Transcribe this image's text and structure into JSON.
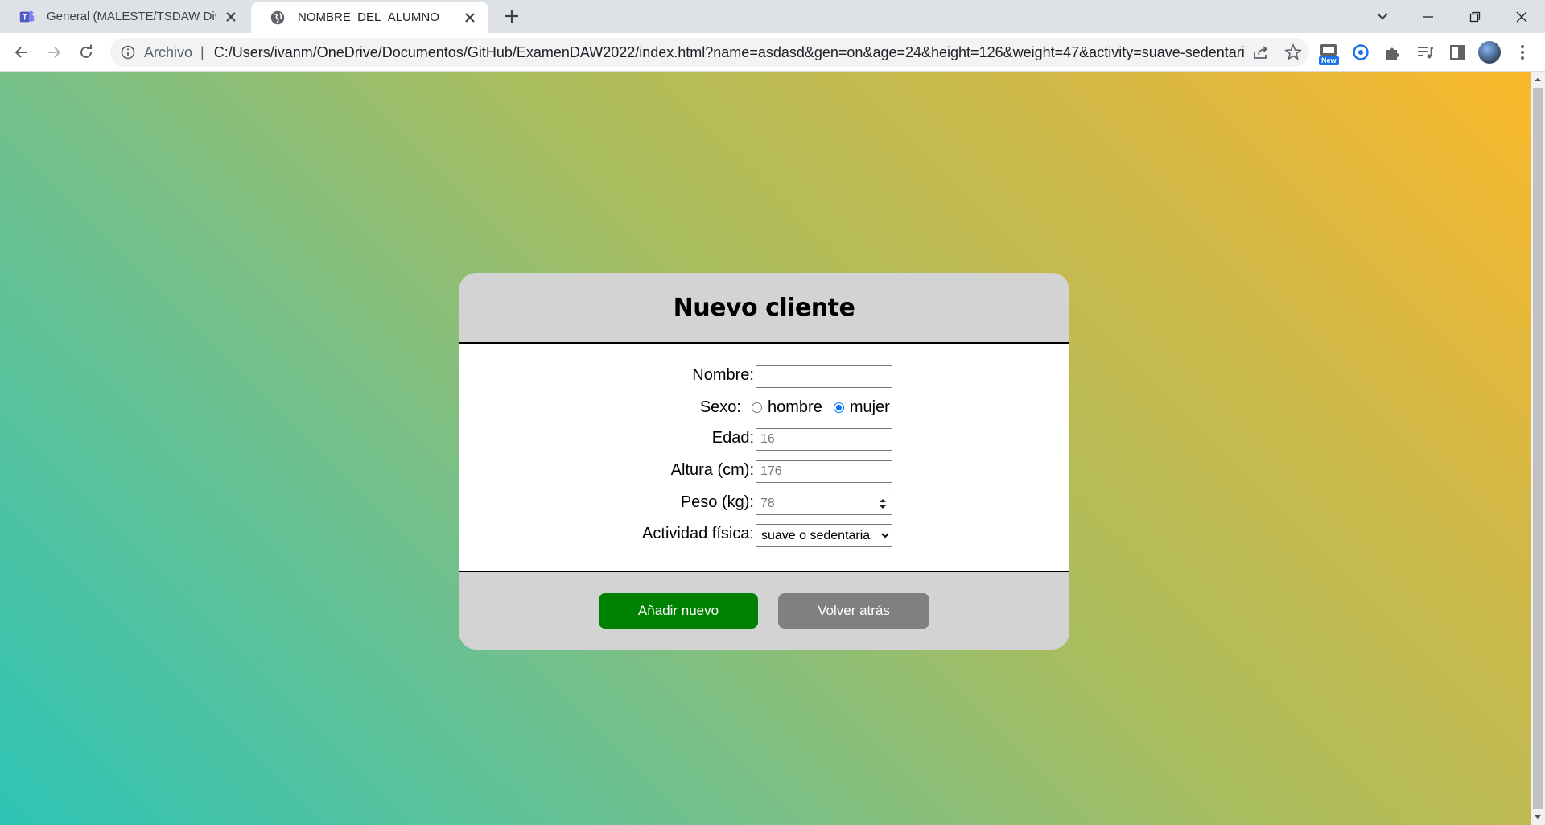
{
  "browser": {
    "tabs": [
      {
        "title": "General (MALESTE/TSDAW Diseño",
        "icon": "teams-icon",
        "active": false
      },
      {
        "title": "NOMBRE_DEL_ALUMNO",
        "icon": "globe-icon",
        "active": true
      }
    ],
    "address": {
      "scheme_label": "Archivo",
      "url": "C:/Users/ivanm/OneDrive/Documentos/GitHub/ExamenDAW2022/index.html?name=asdasd&gen=on&age=24&height=126&weight=47&activity=suave-sedentaria"
    },
    "extension_badge": "New"
  },
  "form": {
    "title": "Nuevo cliente",
    "fields": {
      "name_label": "Nombre:",
      "name_value": "",
      "sex_label": "Sexo:",
      "sex_options": [
        "hombre",
        "mujer"
      ],
      "sex_selected": "mujer",
      "age_label": "Edad:",
      "age_placeholder": "16",
      "height_label": "Altura (cm):",
      "height_placeholder": "176",
      "weight_label": "Peso (kg):",
      "weight_placeholder": "78",
      "activity_label": "Actividad física:",
      "activity_selected": "suave o sedentaria"
    },
    "buttons": {
      "add": "Añadir nuevo",
      "back": "Volver atrás"
    }
  },
  "colors": {
    "add_button": "#008000",
    "back_button": "#808080",
    "card_bg": "#d3d3d3",
    "gradient_start": "#2ec4b6",
    "gradient_end": "#fbb92b"
  }
}
